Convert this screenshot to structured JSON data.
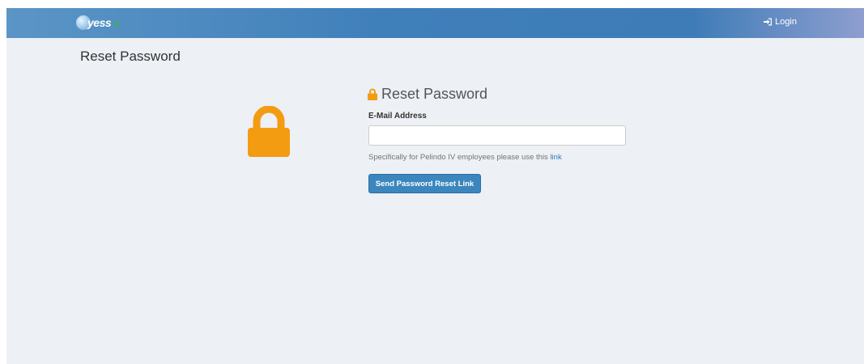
{
  "navbar": {
    "brand_text": "yess",
    "brand_sub": "IV",
    "login_label": "Login",
    "login_icon": "sign-in-icon"
  },
  "page": {
    "title": "Reset Password"
  },
  "card": {
    "hero_icon": "lock-icon",
    "title_icon": "lock-icon",
    "title": "Reset Password",
    "email_label": "E-Mail Address",
    "email_value": "",
    "email_placeholder": "",
    "help_text": "Specifically for Pelindo IV employees please use this",
    "help_link_text": "link",
    "submit_label": "Send Password Reset Link"
  },
  "colors": {
    "navbar": "#3e7cb7",
    "background": "#edf0f5",
    "lock": "#f39c12",
    "button": "#3b87bd",
    "link": "#337ab7"
  }
}
